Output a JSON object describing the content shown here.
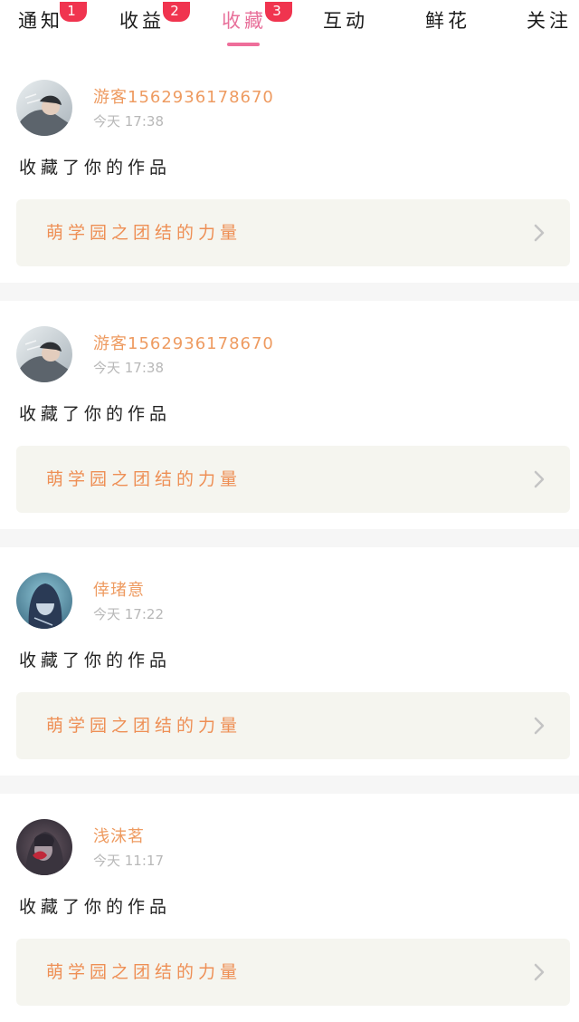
{
  "tabs": [
    {
      "label": "通知",
      "badge": "1"
    },
    {
      "label": "收益",
      "badge": "2"
    },
    {
      "label": "收藏",
      "badge": "3",
      "active": true
    },
    {
      "label": "互动",
      "badge": ""
    },
    {
      "label": "鲜花",
      "badge": ""
    },
    {
      "label": "关注",
      "badge": ""
    }
  ],
  "notifications": [
    {
      "username": "游客1562936178670",
      "time": "今天 17:38",
      "action": "收藏了你的作品",
      "work_title": "萌学园之团结的力量",
      "avatar_icon": "avatar-photo-icon"
    },
    {
      "username": "游客1562936178670",
      "time": "今天 17:38",
      "action": "收藏了你的作品",
      "work_title": "萌学园之团结的力量",
      "avatar_icon": "avatar-photo-icon"
    },
    {
      "username": "倖琽意",
      "time": "今天 17:22",
      "action": "收藏了你的作品",
      "work_title": "萌学园之团结的力量",
      "avatar_icon": "avatar-photo-icon"
    },
    {
      "username": "浅沫茗",
      "time": "今天 11:17",
      "action": "收藏了你的作品",
      "work_title": "萌学园之团结的力量",
      "avatar_icon": "avatar-photo-icon"
    }
  ],
  "colors": {
    "accent": "#ee6e9a",
    "badge": "#f0344f",
    "username": "#ee9b61",
    "work_title": "#ee8f55",
    "work_box_bg": "#f5f5ef",
    "divider": "#f6f6f6"
  }
}
